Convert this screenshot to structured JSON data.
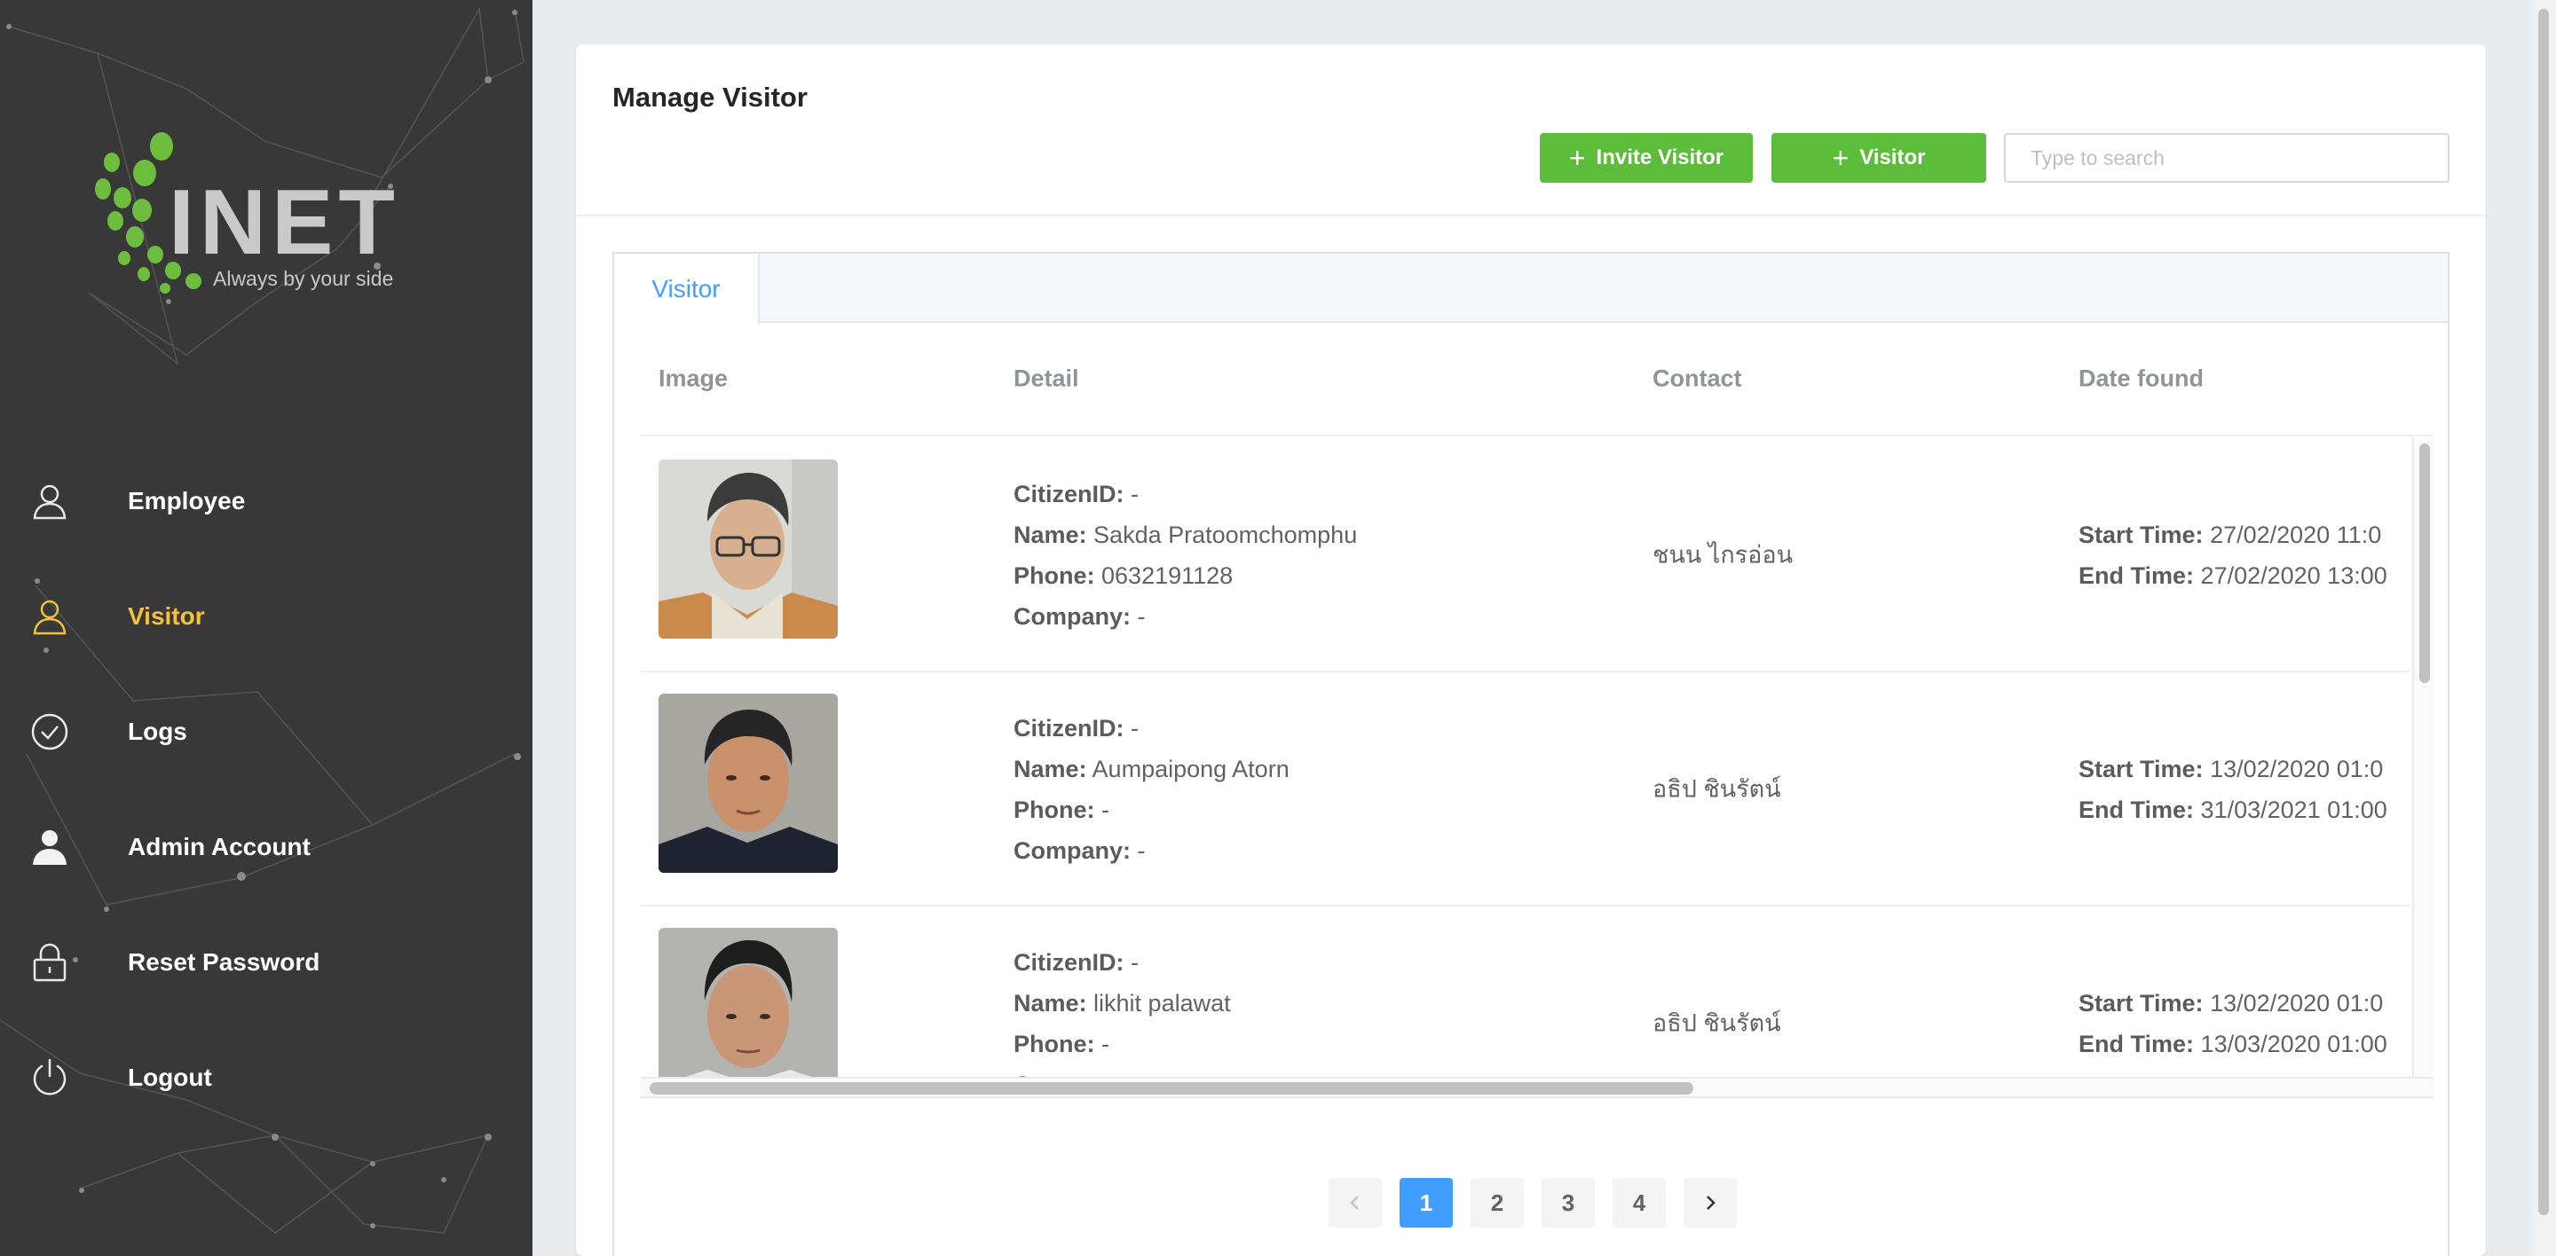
{
  "brand": {
    "name": "INET",
    "tagline": "Always by your side"
  },
  "nav": [
    {
      "label": "Employee",
      "icon": "user-icon",
      "active": false
    },
    {
      "label": "Visitor",
      "icon": "user-icon",
      "active": true
    },
    {
      "label": "Logs",
      "icon": "check-circle-icon",
      "active": false
    },
    {
      "label": "Admin Account",
      "icon": "user-filled-icon",
      "active": false
    },
    {
      "label": "Reset Password",
      "icon": "lock-icon",
      "active": false
    },
    {
      "label": "Logout",
      "icon": "power-icon",
      "active": false
    }
  ],
  "page": {
    "title": "Manage Visitor",
    "invite_button": "Invite Visitor",
    "visitor_button": "Visitor",
    "search_placeholder": "Type to search"
  },
  "tabs": [
    "Visitor"
  ],
  "table": {
    "headers": [
      "Image",
      "Detail",
      "Contact",
      "Date found"
    ],
    "field_labels": {
      "citizen": "CitizenID:",
      "name": "Name:",
      "phone": "Phone:",
      "company": "Company:",
      "start": "Start Time:",
      "end": "End Time:"
    },
    "rows": [
      {
        "citizen_id": "-",
        "name": "Sakda Pratoomchomphu",
        "phone": "0632191128",
        "company": "-",
        "contact": "ชนน ไกรอ่อน",
        "start_time": "27/02/2020 11:0",
        "end_time": "27/02/2020 13:00"
      },
      {
        "citizen_id": "-",
        "name": "Aumpaipong Atorn",
        "phone": "-",
        "company": "-",
        "contact": "อธิป ชินรัตน์",
        "start_time": "13/02/2020 01:0",
        "end_time": "31/03/2021 01:00"
      },
      {
        "citizen_id": "-",
        "name": "likhit palawat",
        "phone": "-",
        "company": "",
        "contact": "อธิป ชินรัตน์",
        "start_time": "13/02/2020 01:0",
        "end_time": "13/03/2020 01:00"
      }
    ]
  },
  "pagination": {
    "pages": [
      "1",
      "2",
      "3",
      "4"
    ],
    "current": "1",
    "prev_icon": "chevron-left-icon",
    "next_icon": "chevron-right-icon"
  },
  "colors": {
    "sidebar": "#383838",
    "active_nav": "#f3c13a",
    "green_button": "#5cbd3a",
    "primary": "#409eff"
  }
}
